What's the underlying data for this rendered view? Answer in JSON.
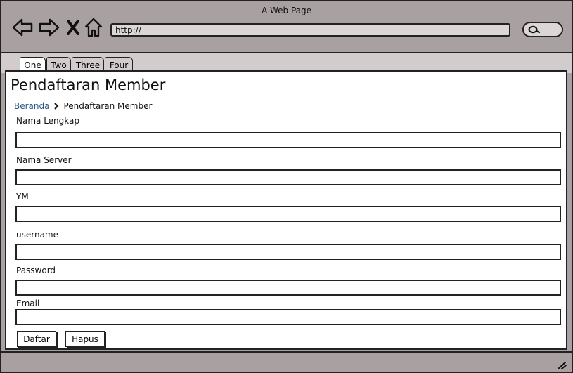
{
  "window": {
    "title": "A Web Page"
  },
  "toolbar": {
    "back_icon": "back-arrow-icon",
    "forward_icon": "forward-arrow-icon",
    "close_icon": "close-icon",
    "home_icon": "home-icon",
    "url": "http://",
    "search_icon": "search-icon"
  },
  "tabs": [
    "One",
    "Two",
    "Three",
    "Four"
  ],
  "page": {
    "title": "Pendaftaran Member",
    "breadcrumb": {
      "home": "Beranda",
      "current": "Pendaftaran Member"
    },
    "fields": [
      {
        "label": "Nama Lengkap",
        "value": ""
      },
      {
        "label": "Nama Server",
        "value": ""
      },
      {
        "label": "YM",
        "value": ""
      },
      {
        "label": "username",
        "value": ""
      },
      {
        "label": "Password",
        "value": ""
      },
      {
        "label": "Email",
        "value": ""
      }
    ],
    "buttons": {
      "submit": "Daftar",
      "reset": "Hapus"
    }
  }
}
